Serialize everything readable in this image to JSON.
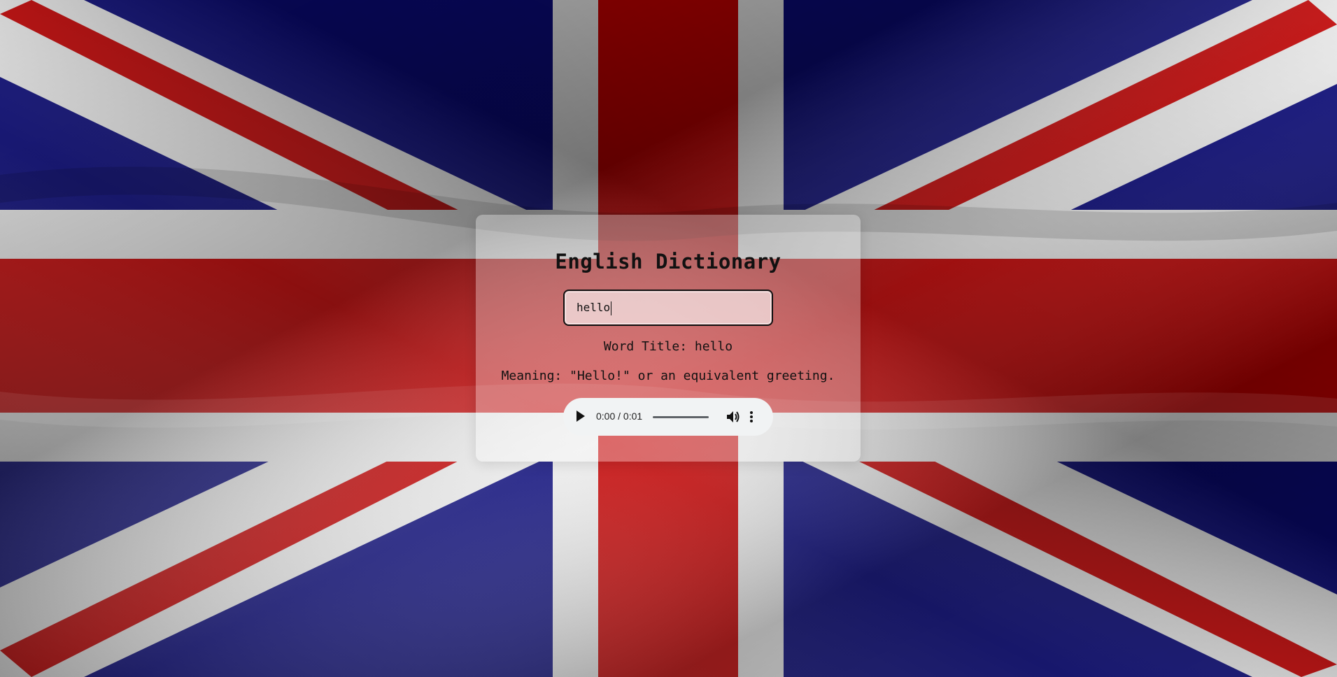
{
  "app": {
    "title": "English Dictionary"
  },
  "search": {
    "value": "hello"
  },
  "result": {
    "word_title": "Word Title: hello",
    "meaning": "Meaning: \"Hello!\" or an equivalent greeting."
  },
  "audio": {
    "time": "0:00 / 0:01",
    "play_icon": "play-icon",
    "volume_icon": "volume-icon",
    "more_icon": "more-vert-icon"
  },
  "background": {
    "subject": "union-jack-flag",
    "colors": {
      "blue": "#0a0a7a",
      "red": "#c40000",
      "white": "#ececec"
    }
  }
}
